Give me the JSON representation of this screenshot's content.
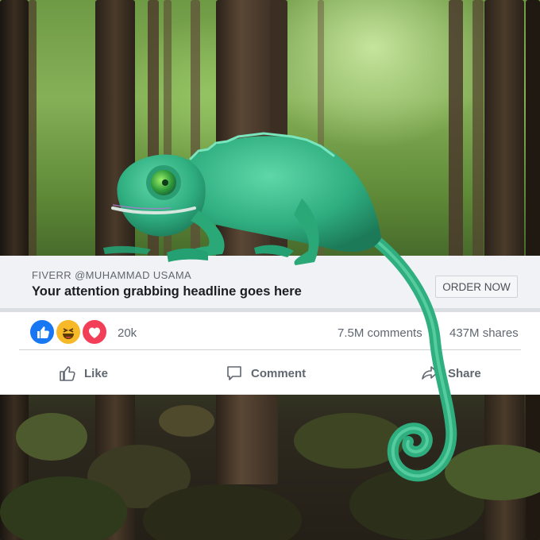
{
  "ad": {
    "brand_label": "FIVERR @MUHAMMAD USAMA",
    "headline": "Your attention grabbing headline goes here",
    "cta_button": "ORDER NOW"
  },
  "engagement": {
    "reaction_count": "20k",
    "comments": "7.5M comments",
    "shares": "437M shares",
    "reactions": [
      "like-icon",
      "haha-icon",
      "love-icon"
    ]
  },
  "actions": {
    "like": "Like",
    "comment": "Comment",
    "share": "Share"
  },
  "colors": {
    "like_blue": "#1877f2",
    "haha_yellow": "#f7b928",
    "love_red": "#f33e58",
    "chameleon_green": "#3fbf8f"
  }
}
